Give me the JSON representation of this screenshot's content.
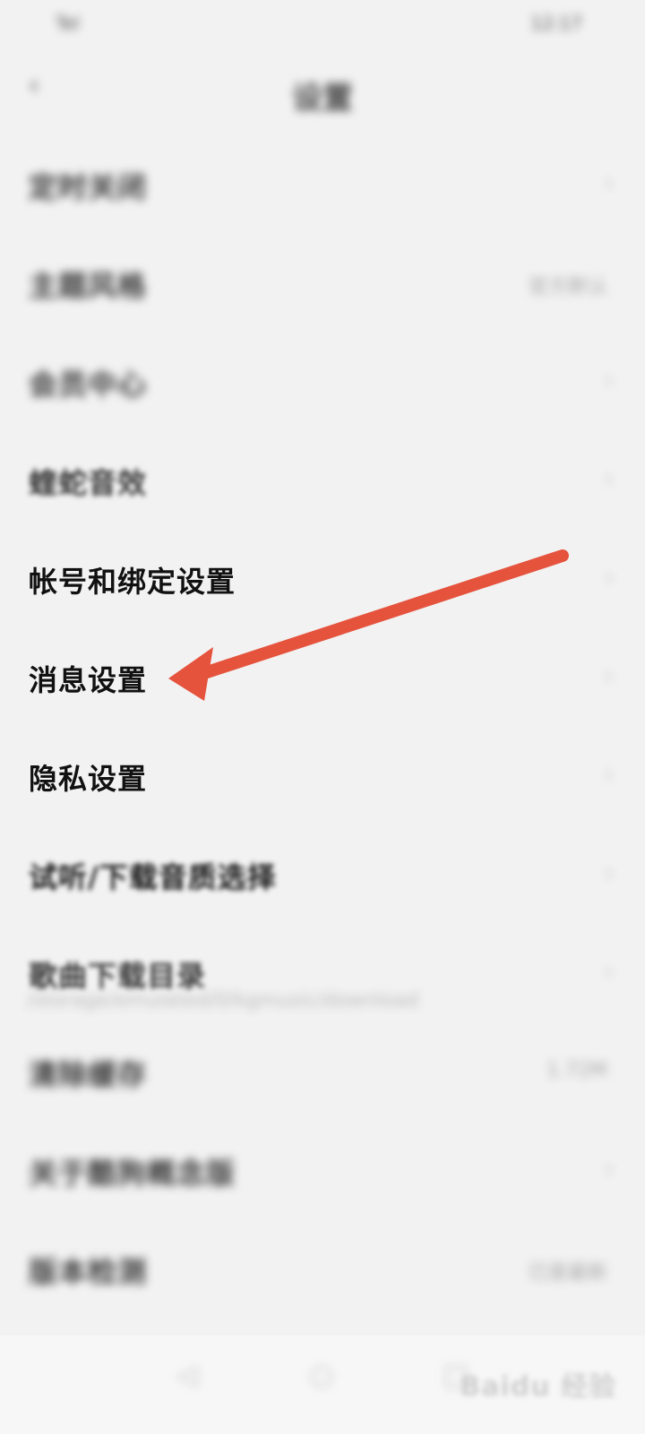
{
  "status_bar": {
    "left": "Tel",
    "right": "12:17"
  },
  "header": {
    "title": "设置"
  },
  "items": [
    {
      "label": "定时关闭",
      "value": ""
    },
    {
      "label": "主题风格",
      "value": "官方默认"
    },
    {
      "label": "会员中心",
      "value": ""
    },
    {
      "label": "蝰蛇音效",
      "value": ""
    },
    {
      "label": "帐号和绑定设置",
      "value": ""
    },
    {
      "label": "消息设置",
      "value": ""
    },
    {
      "label": "隐私设置",
      "value": ""
    },
    {
      "label": "试听/下载音质选择",
      "value": ""
    },
    {
      "label": "歌曲下载目录",
      "sublabel": "/storage/emulated/0/kgmusic/download",
      "value": ""
    },
    {
      "label": "清除缓存",
      "value": "1.72M"
    },
    {
      "label": "关于酷狗概念版",
      "value": ""
    },
    {
      "label": "版本检测",
      "value": "已是最新"
    }
  ],
  "watermark": {
    "text": "Baidu 经验"
  },
  "annotation": {
    "color": "#e5533d"
  }
}
